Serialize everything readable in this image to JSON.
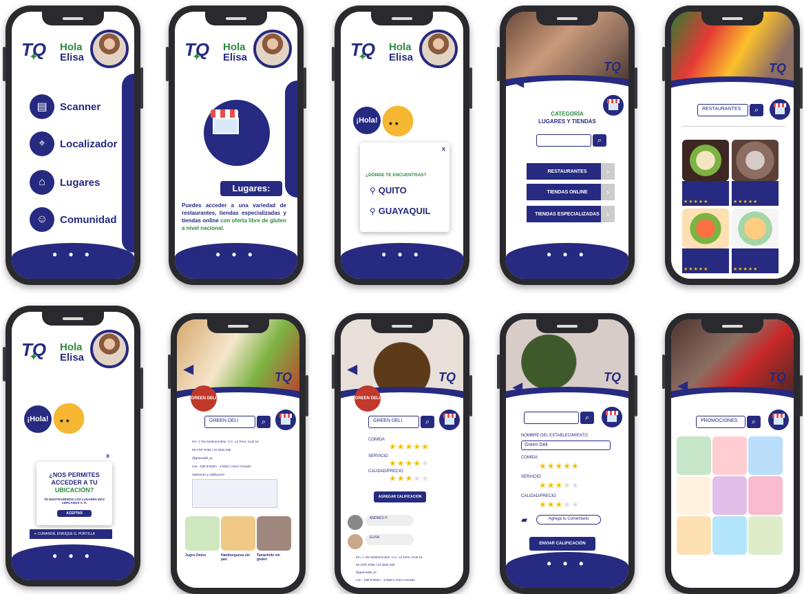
{
  "greeting": {
    "hola": "Hola",
    "name": "Elisa"
  },
  "logo": "TQ",
  "dots": "• • •",
  "menu": [
    "Scanner",
    "Localizador",
    "Lugares",
    "Comunidad"
  ],
  "lugares": {
    "title": "Lugares:",
    "desc_main": "Puedes acceder a una variedad de restaurantes, tiendas especializadas y tiendas online",
    "desc_green": "con oferta libre de gluten a nivel nacional."
  },
  "hola_bubble": "¡Hola!",
  "location": {
    "question": "¿DÓNDE TE ENCUENTRAS?",
    "cities": [
      "QUITO",
      "GUAYAQUIL"
    ],
    "close": "x"
  },
  "categoria": {
    "title": "CATEGORÍA",
    "subtitle": "LUGARES Y TIENDAS",
    "buttons": [
      "RESTAURANTES",
      "TIENDAS ONLINE",
      "TIENDAS ESPECIALIZADAS"
    ]
  },
  "restaurantes": {
    "search": "RESTAURANTES"
  },
  "permission": {
    "title_1": "¿NOS PERMITES",
    "title_2": "ACCEDER A TU",
    "title_3": "UBICACIÓN?",
    "sub": "TE MOSTRAREMOS LOS LUGARES MÁS CERCANOS A TI.",
    "accept": "ACEPTAR",
    "address": "CUMANDÁ, ENRIQUE G. PORTILLA"
  },
  "detail": {
    "search": "GREEN DELI",
    "brand": "GREEN DELI",
    "lines": [
      "Km. 1 Vía Samborondón. C.C. La Torre, local 16.",
      "09 4787 8795 / 04 2834 499",
      "@greendeli_ec",
      "Lun - Sab 9:00am - 4:00pm | Dom Cerrado",
      "Opiniones y calificación"
    ],
    "items": [
      "Jugos Detox",
      "Hamburguesa sin pan",
      "Tamarindo sin gluten"
    ]
  },
  "rating": {
    "labels": [
      "COMIDA",
      "SERVICIO",
      "CALIDAD/PRECIO"
    ],
    "agregar": "AGREGAR CALIFICACIÓN",
    "reviewer_1": "ANDRÉS P.",
    "reviewer_2": "ELISA",
    "nombre_label": "NOMBRE DEL ESTABLECIMIENTO",
    "nombre_value": "Green Deli",
    "comentario": "Agrega tu Comentario",
    "enviar": "ENVIAR CALIFICACIÓN"
  },
  "promos": {
    "search": "PROMOCIONES"
  },
  "colors": {
    "navy": "#262a80",
    "green": "#2b8a3e",
    "star": "#f2c200"
  }
}
